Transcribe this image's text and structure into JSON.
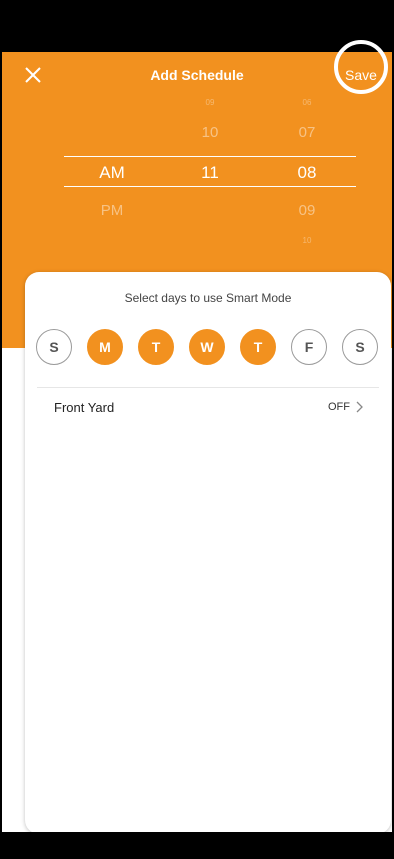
{
  "header": {
    "title": "Add Schedule",
    "save_label": "Save",
    "close_icon": "close-icon"
  },
  "time_picker": {
    "period": {
      "above": "",
      "selected": "AM",
      "below": "PM"
    },
    "hour": {
      "above2": "09",
      "above": "10",
      "selected": "11",
      "below": ""
    },
    "minute": {
      "above2": "06",
      "above": "07",
      "selected": "08",
      "below": "09",
      "below2": "10"
    }
  },
  "days": {
    "label": "Select days to use Smart Mode",
    "items": [
      {
        "label": "S",
        "selected": false
      },
      {
        "label": "M",
        "selected": true
      },
      {
        "label": "T",
        "selected": true
      },
      {
        "label": "W",
        "selected": true
      },
      {
        "label": "T",
        "selected": true
      },
      {
        "label": "F",
        "selected": false
      },
      {
        "label": "S",
        "selected": false
      }
    ]
  },
  "zones": [
    {
      "name": "Front Yard",
      "status": "OFF"
    }
  ],
  "colors": {
    "accent": "#f2911f",
    "background": "#ffffff"
  }
}
